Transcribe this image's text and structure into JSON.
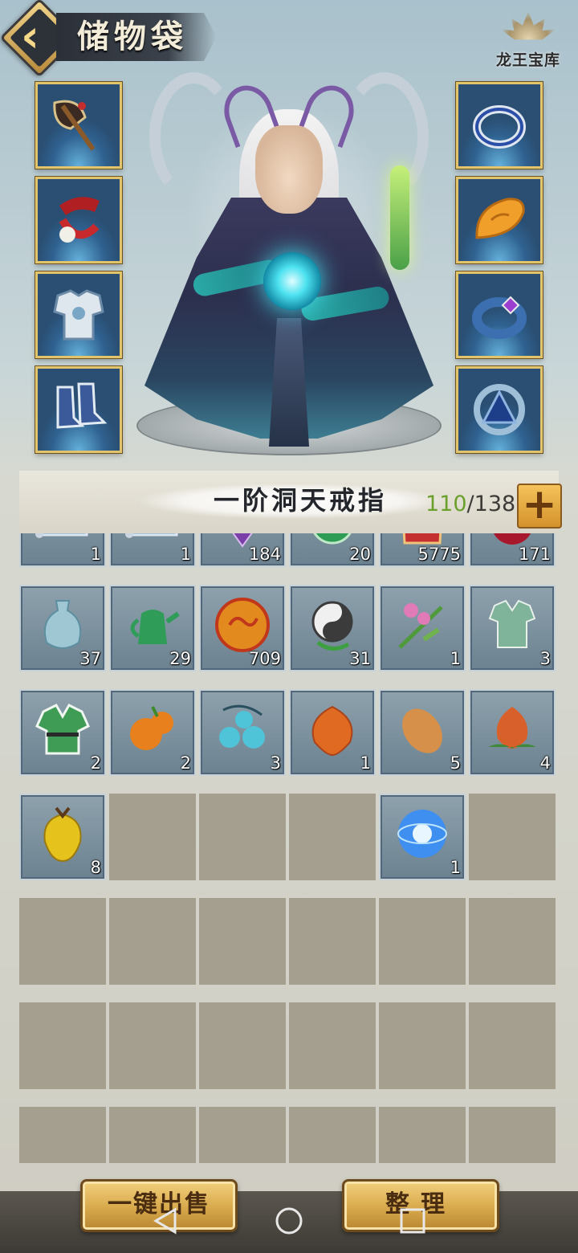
{
  "header": {
    "title": "储物袋",
    "logo_text": "龙王宝库"
  },
  "equipment": {
    "left": [
      {
        "icon": "axe-weapon-icon"
      },
      {
        "icon": "red-necklace-icon"
      },
      {
        "icon": "armor-icon"
      },
      {
        "icon": "boots-icon"
      }
    ],
    "right": [
      {
        "icon": "ring-icon"
      },
      {
        "icon": "orange-pendant-icon"
      },
      {
        "icon": "gem-bracelet-icon"
      },
      {
        "icon": "triangle-amulet-icon"
      }
    ]
  },
  "storage": {
    "ring_name": "一阶洞天戒指",
    "used": "110",
    "separator": "/",
    "capacity": "138"
  },
  "inventory": {
    "rows": [
      [
        {
          "icon": "scroll-icon",
          "qty": "1",
          "color": "#6f9ac7"
        },
        {
          "icon": "scroll-icon",
          "qty": "1",
          "color": "#6f9ac7"
        },
        {
          "icon": "purple-crystal-icon",
          "qty": "184",
          "color": "#7a3fa8"
        },
        {
          "icon": "green-gem-icon",
          "qty": "20",
          "color": "#2e9c55"
        },
        {
          "icon": "red-pouch-icon",
          "qty": "5775",
          "color": "#c43030"
        },
        {
          "icon": "red-fruit-icon",
          "qty": "171",
          "color": "#a8182c"
        }
      ],
      [
        {
          "icon": "vase-icon",
          "qty": "37",
          "color": "#9fc7d3"
        },
        {
          "icon": "jade-teapot-icon",
          "qty": "29",
          "color": "#2f9c58"
        },
        {
          "icon": "fire-orb-icon",
          "qty": "709",
          "color": "#e38a1f"
        },
        {
          "icon": "yinyang-icon",
          "qty": "31",
          "color": "#3b3b3b"
        },
        {
          "icon": "flower-herb-icon",
          "qty": "1",
          "color": "#e07bb8"
        },
        {
          "icon": "green-robe-icon",
          "qty": "3",
          "color": "#7fb39a"
        }
      ],
      [
        {
          "icon": "green-tunic-icon",
          "qty": "2",
          "color": "#3f9c55"
        },
        {
          "icon": "orange-fruit-icon",
          "qty": "2",
          "color": "#e8801e"
        },
        {
          "icon": "blue-berries-icon",
          "qty": "3",
          "color": "#4fc3d8"
        },
        {
          "icon": "lantern-fruit-icon",
          "qty": "1",
          "color": "#e06a22"
        },
        {
          "icon": "sweet-potato-icon",
          "qty": "5",
          "color": "#d7904a"
        },
        {
          "icon": "peach-icon",
          "qty": "4",
          "color": "#d8602a"
        }
      ],
      [
        {
          "icon": "yellow-starfruit-icon",
          "qty": "8",
          "color": "#e6c21c"
        },
        null,
        null,
        null,
        {
          "icon": "lightning-orb-icon",
          "qty": "1",
          "color": "#3f8ff0"
        },
        null
      ],
      [
        null,
        null,
        null,
        null,
        null,
        null
      ],
      [
        null,
        null,
        null,
        null,
        null,
        null
      ],
      [
        null,
        null,
        null,
        null,
        null,
        null
      ]
    ]
  },
  "actions": {
    "sell_all": "一键出售",
    "sort": "整理"
  }
}
